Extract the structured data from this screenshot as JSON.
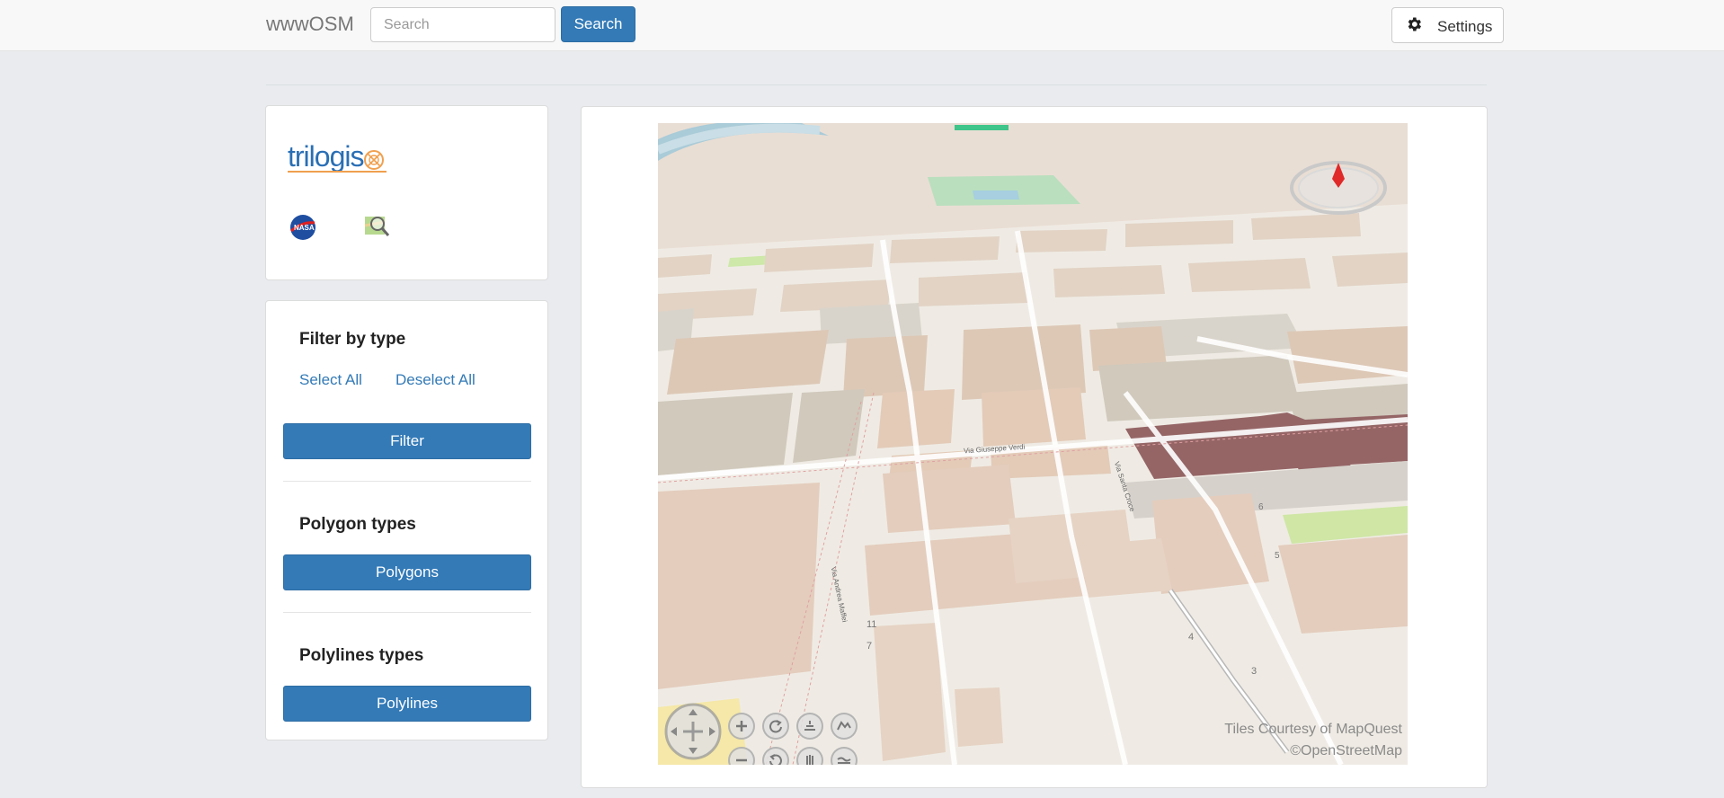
{
  "navbar": {
    "brand": "wwwOSM",
    "search_placeholder": "Search",
    "search_button": "Search",
    "settings_button": "Settings"
  },
  "logos": {
    "brand_logo_text": "trilogis",
    "icons": [
      "nasa-icon",
      "map-search-icon"
    ]
  },
  "filter": {
    "title": "Filter by type",
    "select_all": "Select All",
    "deselect_all": "Deselect All",
    "filter_button": "Filter",
    "polygon_title": "Polygon types",
    "polygon_button": "Polygons",
    "polyline_title": "Polylines types",
    "polyline_button": "Polylines"
  },
  "map": {
    "attribution_line1": "Tiles Courtesy of MapQuest",
    "attribution_line2": "©OpenStreetMap",
    "street_labels": [
      "Via Giuseppe Verdi",
      "Via Andrea Maffei",
      "Via Santa Croce"
    ],
    "house_numbers": [
      "11",
      "7",
      "4",
      "3",
      "6",
      "5"
    ],
    "controls": [
      "pan-icon",
      "zoom-in-icon",
      "zoom-out-icon",
      "rotate-left-icon",
      "rotate-right-icon",
      "tilt-up-icon",
      "tilt-down-icon",
      "exaggerate-icon",
      "flatten-icon",
      "compass-icon"
    ]
  },
  "colors": {
    "primary": "#337ab7",
    "background": "#e9ebee",
    "highlight_building": "#956566"
  }
}
